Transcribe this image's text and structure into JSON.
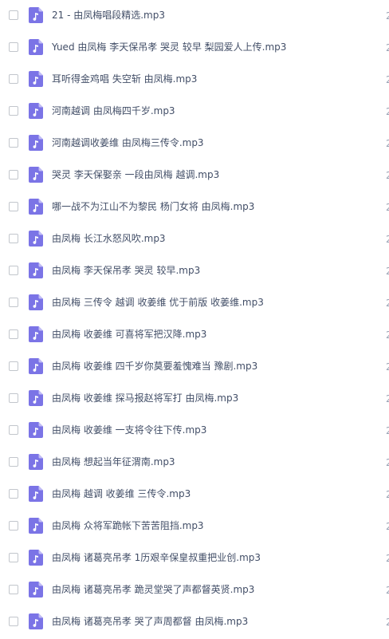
{
  "file_icon": {
    "name": "audio-file-icon",
    "color": "#7b74e6",
    "fold_color": "#c2bdf6",
    "glyph_color": "#ffffff"
  },
  "files": [
    {
      "name": "21 - 由凤梅唱段精选.mp3"
    },
    {
      "name": "Yued 由凤梅 李天保吊孝 哭灵 较早 梨园爱人上传.mp3"
    },
    {
      "name": "耳听得金鸡唱 失空斩 由凤梅.mp3"
    },
    {
      "name": "河南越调 由凤梅四千岁.mp3"
    },
    {
      "name": "河南越调收姜维 由凤梅三传令.mp3"
    },
    {
      "name": "哭灵 李天保娶亲 一段由凤梅 越调.mp3"
    },
    {
      "name": "哪一战不为江山不为黎民 杨门女将 由凤梅.mp3"
    },
    {
      "name": "由凤梅 长江水怒风吹.mp3"
    },
    {
      "name": "由凤梅 李天保吊孝 哭灵 较早.mp3"
    },
    {
      "name": "由凤梅 三传令 越调 收姜维 优于前版 收姜维.mp3"
    },
    {
      "name": "由凤梅 收姜维 可喜将军把汉降.mp3"
    },
    {
      "name": "由凤梅 收姜维 四千岁你莫要羞愧难当 豫剧.mp3"
    },
    {
      "name": "由凤梅 收姜维 探马报赵将军打 由凤梅.mp3"
    },
    {
      "name": "由凤梅 收姜维 一支将令往下传.mp3"
    },
    {
      "name": "由凤梅 想起当年征渭南.mp3"
    },
    {
      "name": "由凤梅 越调 收姜维 三传令.mp3"
    },
    {
      "name": "由凤梅 众将军跪帐下苦苦阻挡.mp3"
    },
    {
      "name": "由凤梅 诸葛亮吊孝 1历艰辛保皇叔重把业创.mp3"
    },
    {
      "name": "由凤梅 诸葛亮吊孝 跪灵堂哭了声都督英贤.mp3"
    },
    {
      "name": "由凤梅 诸葛亮吊孝 哭了声周都督 由凤梅.mp3"
    }
  ],
  "edge_glyph": "2"
}
